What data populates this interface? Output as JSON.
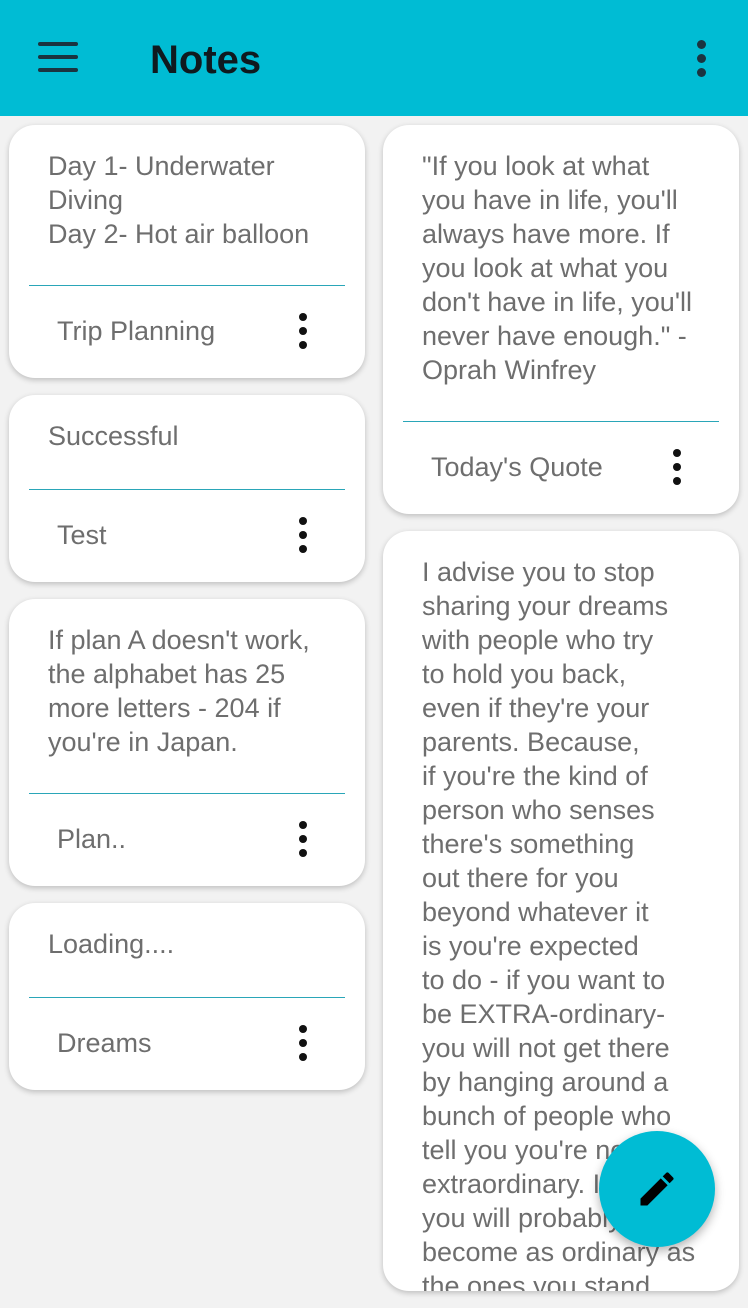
{
  "app_bar": {
    "title": "Notes",
    "menu_icon": "hamburger-menu-icon",
    "overflow_icon": "more-vert-icon"
  },
  "notes_left": [
    {
      "body": "Day 1- Underwater\nDiving\nDay 2- Hot air balloon",
      "title": "Trip Planning"
    },
    {
      "body": "Successful",
      "title": "Test"
    },
    {
      "body": "If plan A doesn't work,\nthe alphabet has 25\nmore letters - 204 if\nyou're in Japan.",
      "title": "Plan.."
    },
    {
      "body": "Loading....",
      "title": "Dreams"
    }
  ],
  "notes_right": [
    {
      "body": "\"If you look at what\nyou have in life, you'll\nalways have more. If\nyou look at what you\ndon't have in life, you'll\nnever have enough.\" -\nOprah Winfrey",
      "title": "Today's Quote"
    },
    {
      "body": "I advise you to stop\nsharing your dreams\nwith people who try\nto hold you back,\neven if they're your\nparents. Because,\nif you're the kind of\nperson who senses\nthere's something\nout there for you\nbeyond whatever it\nis you're expected\nto do - if you want to\nbe EXTRA-ordinary-\nyou will not get there\nby hanging around a\nbunch of people who\ntell you you're not\nextraordinary. If you do,\nyou will probably just\nbecome as ordinary as\nthe ones you stand\nwith.",
      "title": ""
    }
  ],
  "fab": {
    "icon": "edit-pencil-icon"
  },
  "colors": {
    "accent": "#00bcd4",
    "divider": "#2aa6b8",
    "text": "#6e6e6e"
  }
}
